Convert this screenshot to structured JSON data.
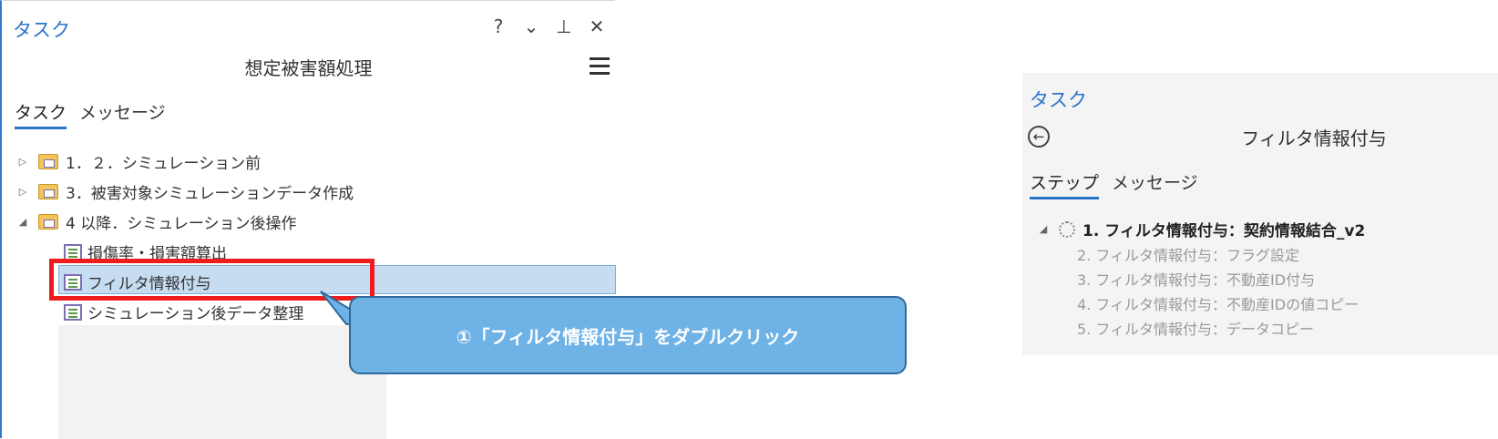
{
  "left": {
    "title": "タスク",
    "controls": [
      "?",
      "⌄",
      "⊥",
      "✕"
    ],
    "task_name": "想定被害額処理",
    "tabs": [
      {
        "label": "タスク",
        "active": true
      },
      {
        "label": "メッセージ",
        "active": false
      }
    ],
    "tree": [
      {
        "label": "1．２．シミュレーション前",
        "expanded": false
      },
      {
        "label": "3．被害対象シミュレーションデータ作成",
        "expanded": false
      },
      {
        "label": "4 以降．シミュレーション後操作",
        "expanded": true
      }
    ],
    "tasks": [
      {
        "label": "損傷率・損害額算出"
      },
      {
        "label": "フィルタ情報付与",
        "selected": true
      },
      {
        "label": "シミュレーション後データ整理"
      }
    ]
  },
  "callout": {
    "text": "①「フィルタ情報付与」をダブルクリック"
  },
  "right": {
    "title": "タスク",
    "task_name": "フィルタ情報付与",
    "tabs": [
      {
        "label": "ステップ",
        "active": true
      },
      {
        "label": "メッセージ",
        "active": false
      }
    ],
    "steps": [
      {
        "label": "1. フィルタ情報付与：契約情報結合_v2",
        "status": "active"
      },
      {
        "label": "2. フィルタ情報付与：フラグ設定",
        "status": "pending"
      },
      {
        "label": "3. フィルタ情報付与：不動産ID付与",
        "status": "pending"
      },
      {
        "label": "4. フィルタ情報付与：不動産IDの値コピー",
        "status": "pending"
      },
      {
        "label": "5. フィルタ情報付与：データコピー",
        "status": "pending"
      }
    ]
  },
  "colors": {
    "accent": "#2b75c9",
    "highlight": "#ee1c1c",
    "callout": "#6eb2e6",
    "selection": "#c6dcf1"
  }
}
